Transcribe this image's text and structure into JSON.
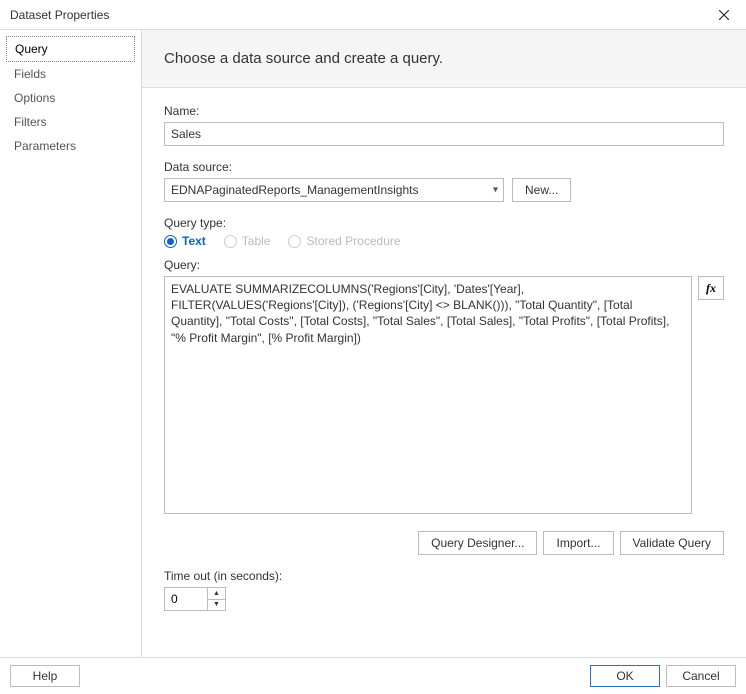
{
  "window": {
    "title": "Dataset Properties"
  },
  "sidebar": {
    "items": [
      {
        "label": "Query",
        "selected": true
      },
      {
        "label": "Fields",
        "selected": false
      },
      {
        "label": "Options",
        "selected": false
      },
      {
        "label": "Filters",
        "selected": false
      },
      {
        "label": "Parameters",
        "selected": false
      }
    ]
  },
  "header": {
    "text": "Choose a data source and create a query."
  },
  "fields": {
    "name_label": "Name:",
    "name_value": "Sales",
    "data_source_label": "Data source:",
    "data_source_value": "EDNAPaginatedReports_ManagementInsights",
    "new_button": "New...",
    "query_type_label": "Query type:",
    "query_types": {
      "text": "Text",
      "table": "Table",
      "stored_procedure": "Stored Procedure",
      "selected": "text"
    },
    "query_label": "Query:",
    "query_value": "EVALUATE SUMMARIZECOLUMNS('Regions'[City], 'Dates'[Year], FILTER(VALUES('Regions'[City]), ('Regions'[City] <> BLANK())), \"Total Quantity\", [Total Quantity], \"Total Costs\", [Total Costs], \"Total Sales\", [Total Sales], \"Total Profits\", [Total Profits], \"% Profit Margin\", [% Profit Margin])",
    "fx_label": "fx",
    "query_designer_button": "Query Designer...",
    "import_button": "Import...",
    "validate_button": "Validate Query",
    "timeout_label": "Time out (in seconds):",
    "timeout_value": "0"
  },
  "footer": {
    "help": "Help",
    "ok": "OK",
    "cancel": "Cancel"
  }
}
